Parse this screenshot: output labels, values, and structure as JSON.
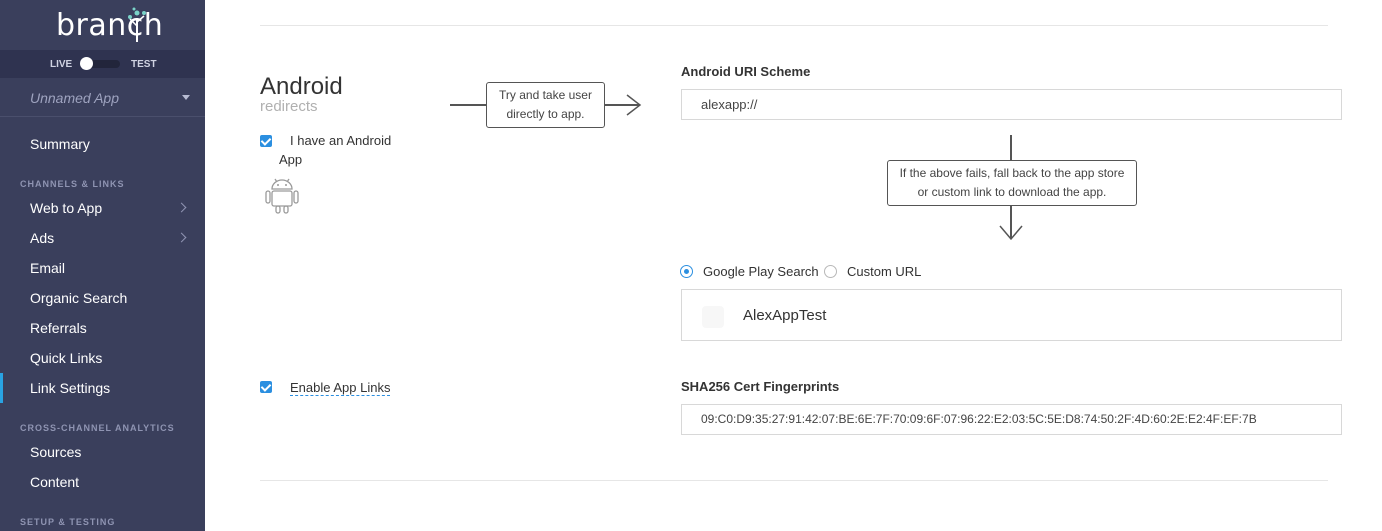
{
  "sidebar": {
    "logo": "branch",
    "env": {
      "live": "LIVE",
      "test": "TEST"
    },
    "app_name": "Unnamed App",
    "summary": "Summary",
    "sections": {
      "channels": "CHANNELS & LINKS",
      "analytics": "CROSS-CHANNEL ANALYTICS",
      "setup": "SETUP & TESTING"
    },
    "items": [
      {
        "label": "Web to App",
        "has_children": true
      },
      {
        "label": "Ads",
        "has_children": true
      },
      {
        "label": "Email"
      },
      {
        "label": "Organic Search"
      },
      {
        "label": "Referrals"
      },
      {
        "label": "Quick Links"
      },
      {
        "label": "Link Settings",
        "active": true
      }
    ],
    "analytics_items": [
      {
        "label": "Sources"
      },
      {
        "label": "Content"
      }
    ],
    "colors": {
      "background": "#3a3f5c",
      "active_accent": "#29a3e3"
    }
  },
  "android": {
    "title": "Android",
    "subtitle": "redirects",
    "has_app_label_1": "I have an Android",
    "has_app_label_2": "App",
    "has_app_checked": true,
    "enable_app_links_label": "Enable App Links",
    "enable_app_links_checked": true,
    "icon": "android-robot-icon"
  },
  "flow": {
    "tip1_line1": "Try and take user",
    "tip1_line2": "directly to app.",
    "tip2_line1": "If the above fails, fall back to the app store",
    "tip2_line2": "or custom link to download the app."
  },
  "uri_scheme": {
    "label": "Android URI Scheme",
    "value": "alexapp://"
  },
  "fallback": {
    "options": [
      {
        "label": "Google Play Search",
        "selected": true
      },
      {
        "label": "Custom URL",
        "selected": false
      }
    ],
    "selected_app": "AlexAppTest"
  },
  "sha256": {
    "label": "SHA256 Cert Fingerprints",
    "value": "09:C0:D9:35:27:91:42:07:BE:6E:7F:70:09:6F:07:96:22:E2:03:5C:5E:D8:74:50:2F:4D:60:2E:E2:4F:EF:7B"
  },
  "colors": {
    "accent": "#2b8fe0"
  }
}
